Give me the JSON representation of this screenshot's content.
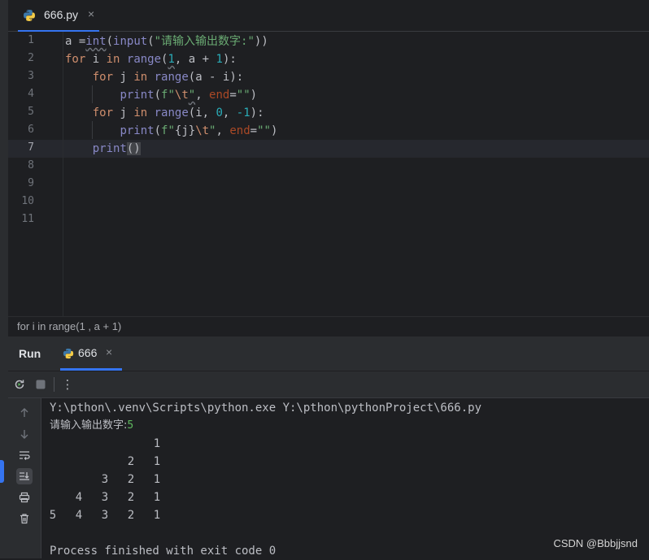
{
  "editor_tab": {
    "filename": "666.py",
    "close": "×"
  },
  "editor": {
    "line_numbers": [
      "1",
      "2",
      "3",
      "4",
      "5",
      "6",
      "7",
      "8",
      "9",
      "10",
      "11"
    ],
    "current_line": 7,
    "code": [
      [
        "a =",
        "int",
        "(",
        "input",
        "(",
        "\"请输入输出数字:\"",
        "))"
      ],
      [
        "for",
        " i ",
        "in",
        " ",
        "range",
        "(",
        "1",
        ", a + ",
        "1",
        "):"
      ],
      [
        "    ",
        "for",
        " j ",
        "in",
        " ",
        "range",
        "(a - i):"
      ],
      [
        "        ",
        "print",
        "(",
        "f\"",
        "\\t",
        "\"",
        ", ",
        "end",
        "=",
        "\"\"",
        ")"
      ],
      [
        "    ",
        "for",
        " j ",
        "in",
        " ",
        "range",
        "(i, ",
        "0",
        ", ",
        "-1",
        "):"
      ],
      [
        "        ",
        "print",
        "(",
        "f\"",
        "{j}",
        "\\t",
        "\"",
        ", ",
        "end",
        "=",
        "\"\"",
        ")"
      ],
      [
        "    ",
        "print",
        "()"
      ]
    ]
  },
  "breadcrumb": "for i in range(1 , a + 1)",
  "run_panel": {
    "title": "Run",
    "tab_name": "666",
    "tab_close": "×",
    "more": "⋮"
  },
  "console": {
    "command": "Y:\\pthon\\.venv\\Scripts\\python.exe Y:\\pthon\\pythonProject\\666.py",
    "prompt": "请输入输出数字:",
    "input_value": "5",
    "rows": [
      [
        "",
        "",
        "",
        "",
        "1"
      ],
      [
        "",
        "",
        "",
        "2",
        "1"
      ],
      [
        "",
        "",
        "3",
        "2",
        "1"
      ],
      [
        "",
        "4",
        "3",
        "2",
        "1"
      ],
      [
        "5",
        "4",
        "3",
        "2",
        "1"
      ]
    ],
    "exit_message": "Process finished with exit code 0"
  },
  "watermark": "CSDN @Bbbjjsnd",
  "colors": {
    "accent": "#3574f0",
    "background": "#1e1f22",
    "panel": "#2b2d30"
  }
}
